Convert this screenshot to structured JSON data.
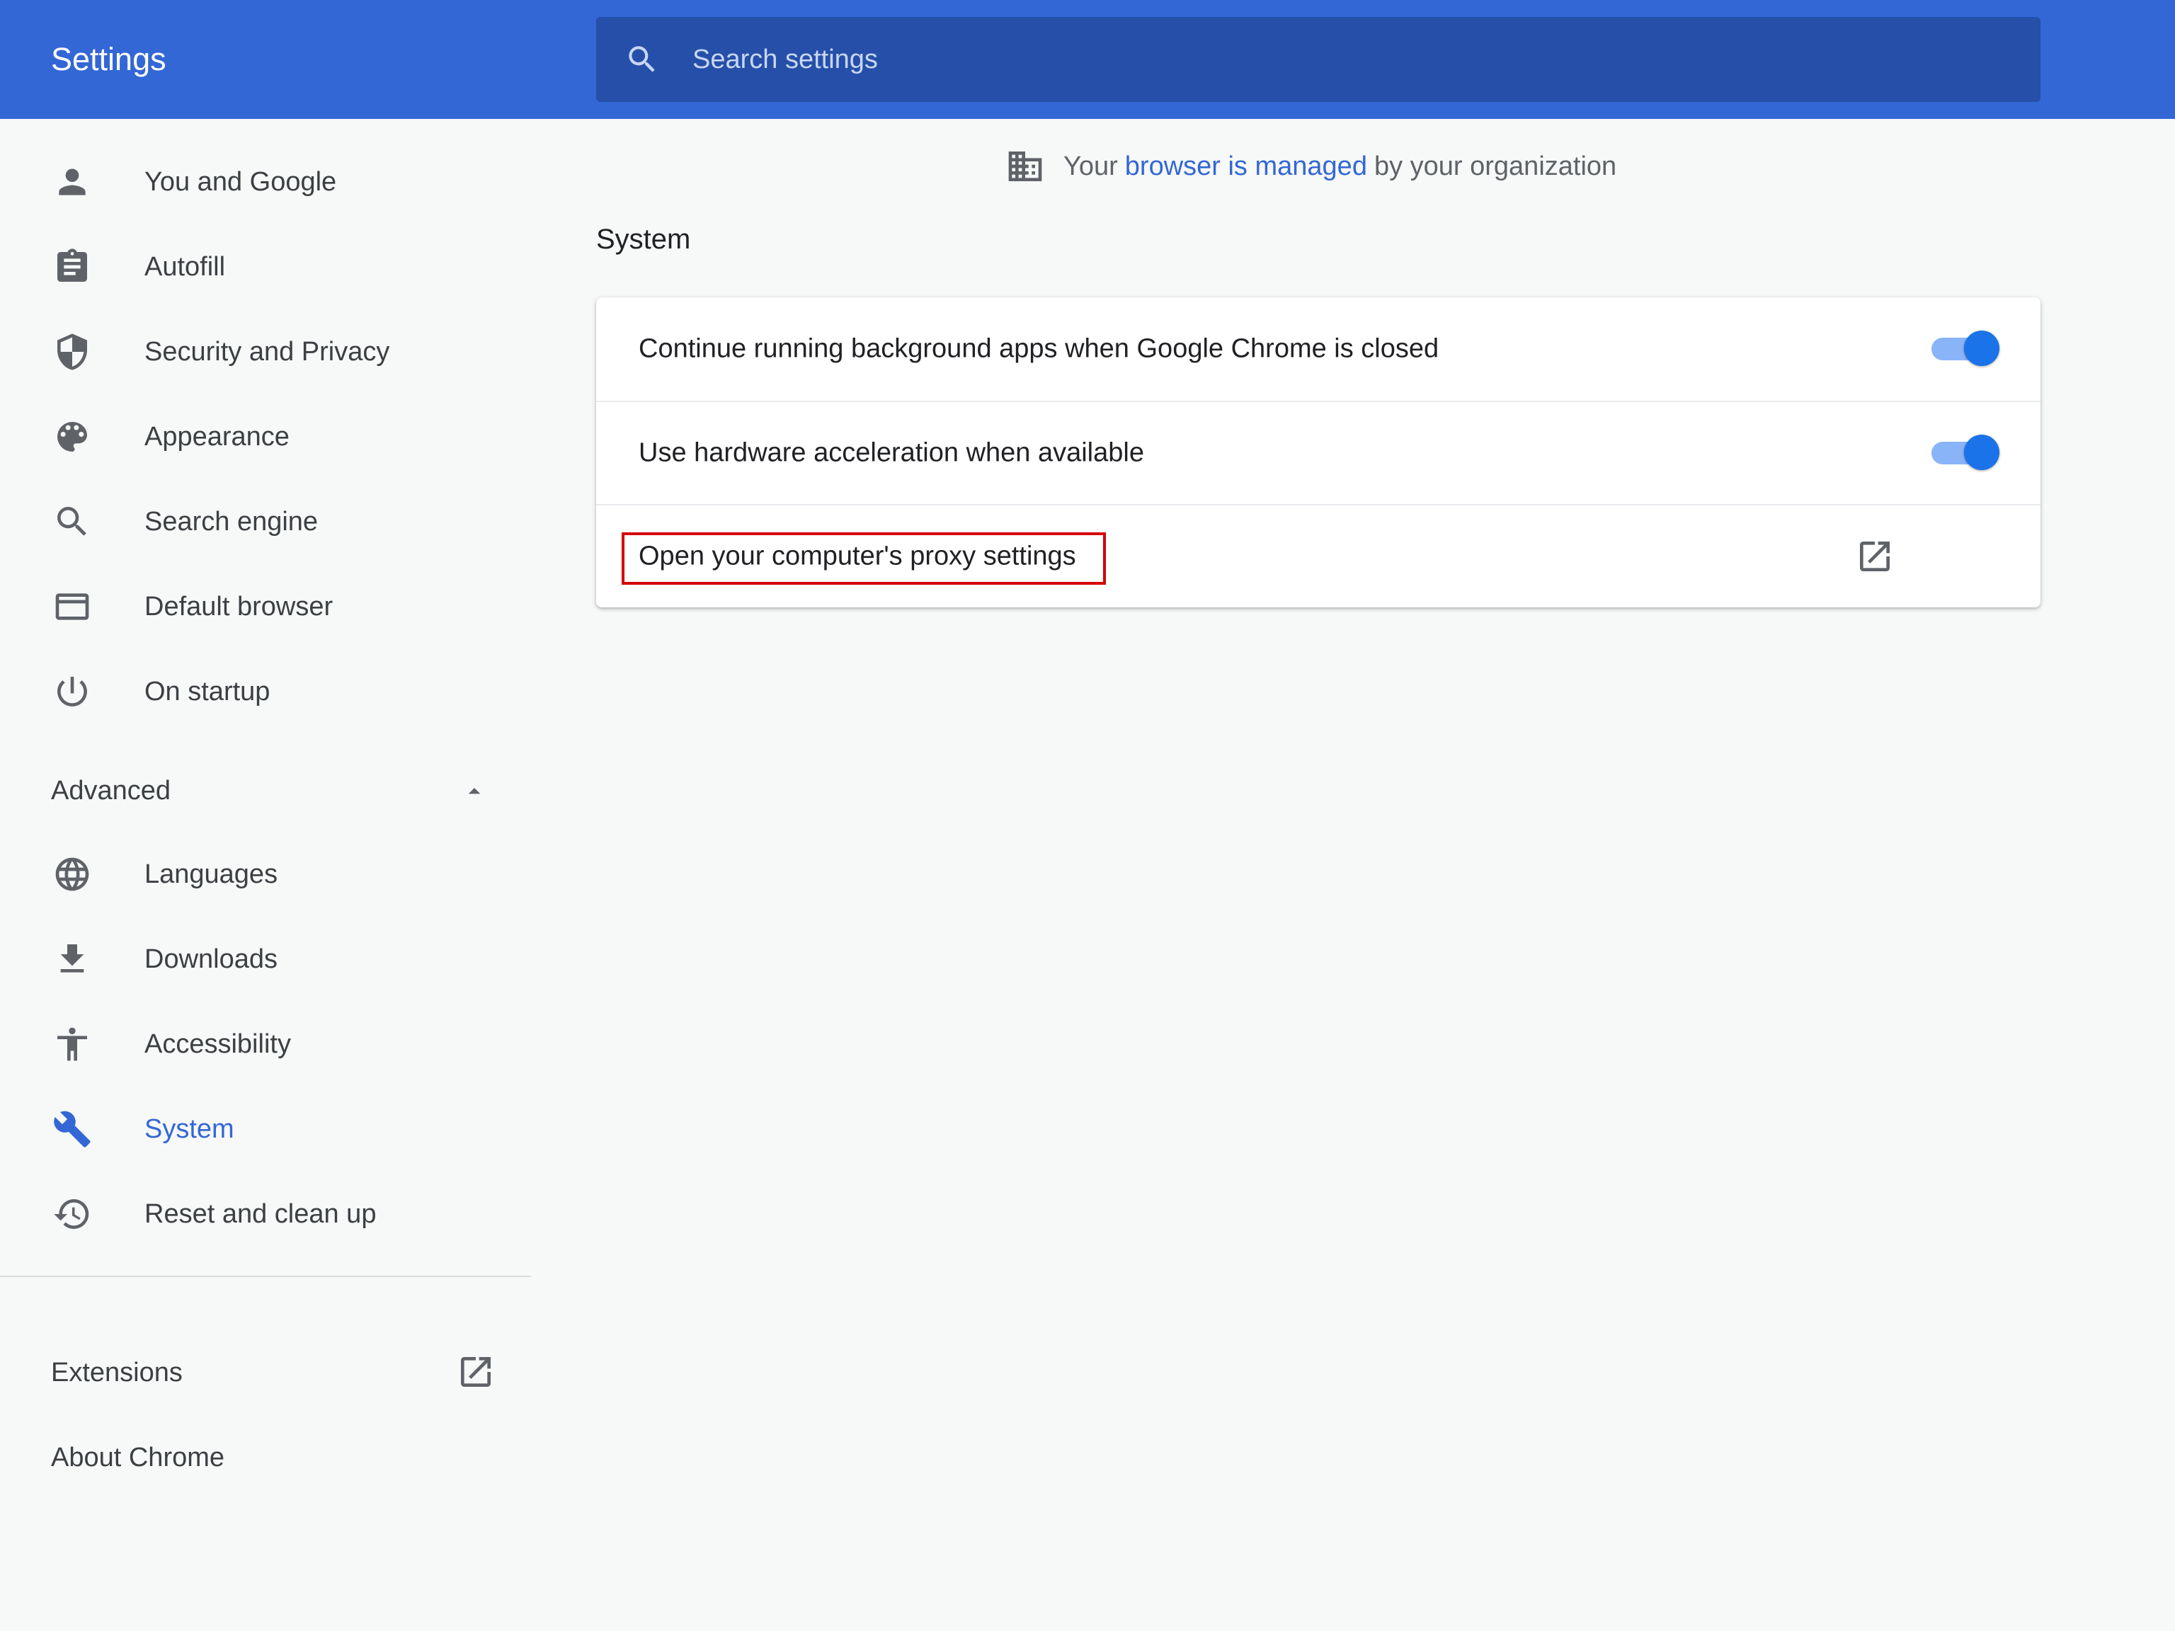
{
  "header": {
    "title": "Settings",
    "search_placeholder": "Search settings"
  },
  "sidebar": {
    "items": [
      {
        "label": "You and Google",
        "icon": "person-icon"
      },
      {
        "label": "Autofill",
        "icon": "clipboard-icon"
      },
      {
        "label": "Security and Privacy",
        "icon": "shield-icon"
      },
      {
        "label": "Appearance",
        "icon": "palette-icon"
      },
      {
        "label": "Search engine",
        "icon": "search-icon"
      },
      {
        "label": "Default browser",
        "icon": "browser-window-icon"
      },
      {
        "label": "On startup",
        "icon": "power-icon"
      }
    ],
    "advanced": {
      "label": "Advanced",
      "expanded": true,
      "items": [
        {
          "label": "Languages",
          "icon": "globe-icon"
        },
        {
          "label": "Downloads",
          "icon": "download-icon"
        },
        {
          "label": "Accessibility",
          "icon": "accessibility-icon"
        },
        {
          "label": "System",
          "icon": "wrench-icon",
          "active": true
        },
        {
          "label": "Reset and clean up",
          "icon": "restore-icon"
        }
      ]
    },
    "extensions_label": "Extensions",
    "about_label": "About Chrome"
  },
  "managed_notice": {
    "prefix": "Your",
    "link": "browser is managed",
    "suffix": "by your organization"
  },
  "main": {
    "section_title": "System",
    "rows": [
      {
        "label": "Continue running background apps when Google Chrome is closed",
        "toggle_on": true
      },
      {
        "label": "Use hardware acceleration when available",
        "toggle_on": true
      },
      {
        "label": "Open your computer's proxy settings"
      }
    ]
  },
  "colors": {
    "header": "#3367d6",
    "accent": "#1a73e8",
    "highlight_box": "#d50000"
  }
}
